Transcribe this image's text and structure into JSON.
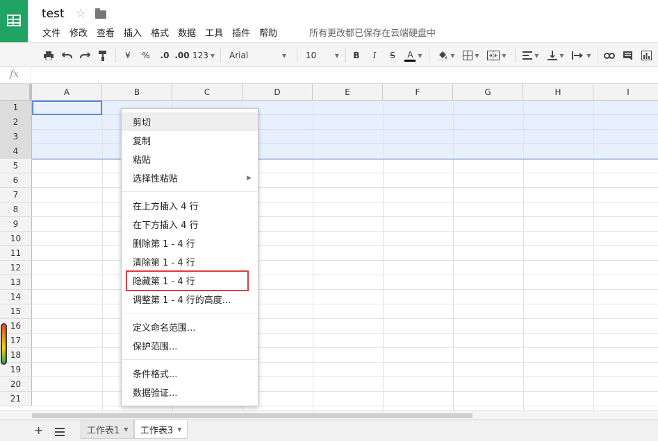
{
  "doc": {
    "title": "test",
    "save_status": "所有更改都已保存在云端硬盘中"
  },
  "menubar": [
    "文件",
    "修改",
    "查看",
    "插入",
    "格式",
    "数据",
    "工具",
    "插件",
    "帮助"
  ],
  "toolbar": {
    "currency": "¥",
    "percent": "%",
    "decrease_decimals": ".0",
    "increase_decimals": ".00",
    "more_formats": "123",
    "font": "Arial",
    "font_size": "10",
    "bold": "B",
    "italic": "I",
    "strikethrough": "S",
    "text_color": "A"
  },
  "formula_bar": {
    "fx_label": "fx",
    "value": ""
  },
  "columns": [
    "A",
    "B",
    "C",
    "D",
    "E",
    "F",
    "G",
    "H",
    "I"
  ],
  "rows": [
    "1",
    "2",
    "3",
    "4",
    "5",
    "6",
    "7",
    "8",
    "9",
    "10",
    "11",
    "12",
    "13",
    "14",
    "15",
    "16",
    "17",
    "18",
    "19",
    "20",
    "21"
  ],
  "selection": {
    "rows": "1 - 4"
  },
  "context_menu": {
    "groups": [
      [
        {
          "label": "剪切",
          "hover": true
        },
        {
          "label": "复制"
        },
        {
          "label": "粘贴"
        },
        {
          "label": "选择性粘贴",
          "submenu": true
        }
      ],
      [
        {
          "label": "在上方插入 4 行"
        },
        {
          "label": "在下方插入 4 行"
        },
        {
          "label": "删除第 1 - 4 行"
        },
        {
          "label": "清除第 1 - 4 行"
        },
        {
          "label": "隐藏第 1 - 4 行",
          "highlighted": true
        },
        {
          "label": "调整第 1 - 4 行的高度..."
        }
      ],
      [
        {
          "label": "定义命名范围..."
        },
        {
          "label": "保护范围..."
        }
      ],
      [
        {
          "label": "条件格式..."
        },
        {
          "label": "数据验证..."
        }
      ]
    ]
  },
  "sheets": [
    {
      "name": "工作表1",
      "active": false
    },
    {
      "name": "工作表3",
      "active": true
    }
  ],
  "colors": {
    "brand": "#1fa463",
    "selection": "#e8f0fe",
    "active_border": "#5b87e6",
    "highlight": "#e03a3a"
  }
}
